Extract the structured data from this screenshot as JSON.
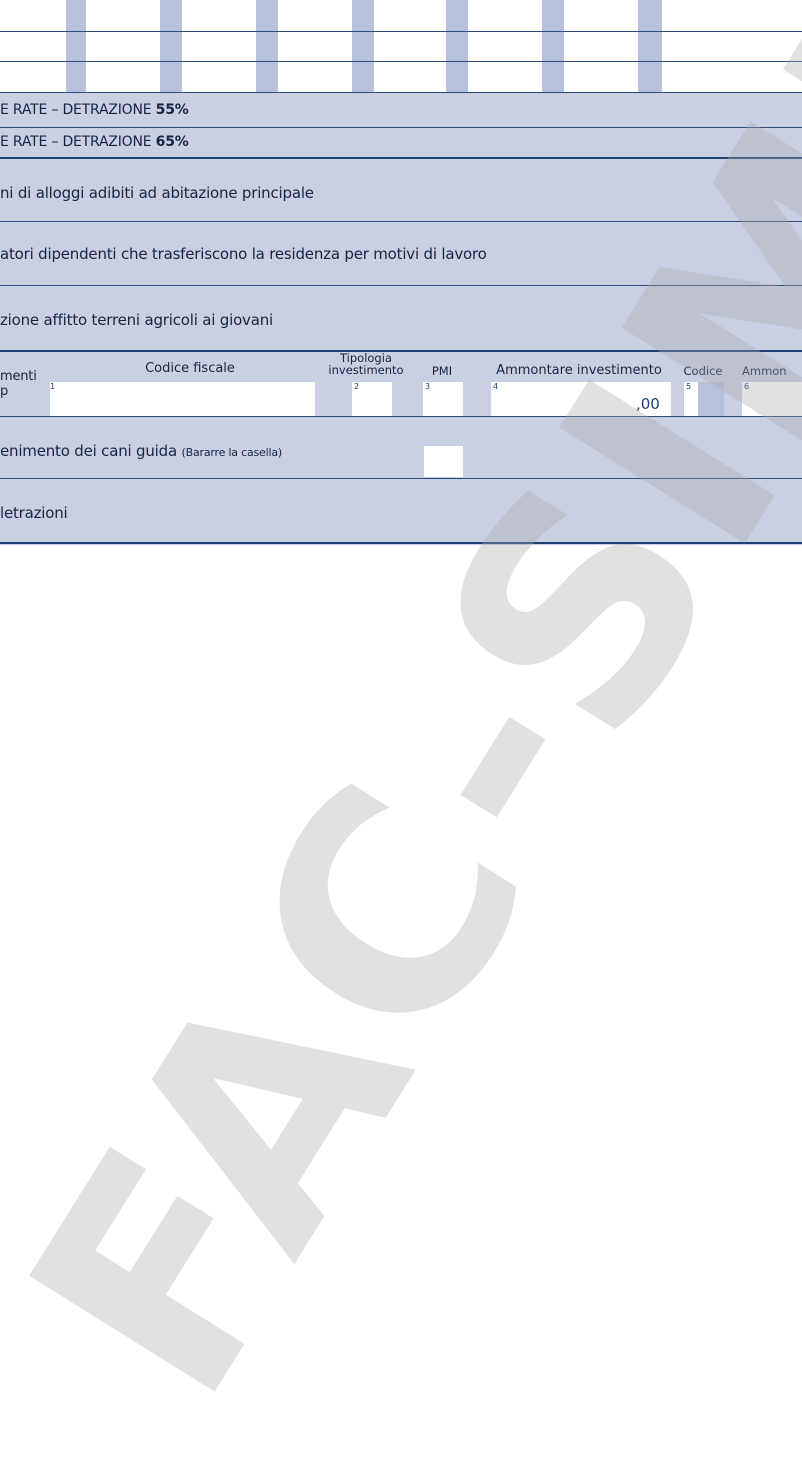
{
  "rows": {
    "rate55": {
      "prefix": "E RATE – DETRAZIONE ",
      "pct": "55%"
    },
    "rate65": {
      "prefix": "E RATE – DETRAZIONE ",
      "pct": "65%"
    },
    "alloggi": "ni di alloggi adibiti ad abitazione principale",
    "lavoratori": "atori dipendenti che trasferiscono la residenza per motivi di lavoro",
    "terreni": "zione affitto terreni agricoli ai giovani",
    "cani_main": "enimento dei cani guida ",
    "cani_note": "(Bararre la casella)",
    "altre": "letrazioni"
  },
  "investimenti": {
    "left_line1": "menti",
    "left_line2": "p",
    "headers": {
      "codice_fiscale": "Codice fiscale",
      "tipologia_1": "Tipologia",
      "tipologia_2": "investimento",
      "pmi": "PMI",
      "ammontare": "Ammontare investimento",
      "codice": "Codice",
      "ammon": "Ammon"
    },
    "field_numbers": [
      "1",
      "2",
      "3",
      "4",
      "5",
      "6"
    ],
    "ammontare_value": ",00"
  },
  "watermark": "FAC-SIMILE"
}
